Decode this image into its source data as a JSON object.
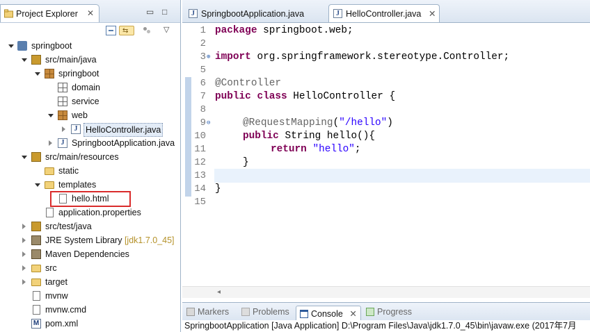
{
  "project_explorer": {
    "title": "Project Explorer",
    "close": "✕",
    "minimize": "▭",
    "maximize": "□",
    "menu": "▽"
  },
  "tree": [
    {
      "label": "springboot",
      "icon": "maven-project-icon"
    },
    {
      "label": "src/main/java",
      "icon": "source-folder-icon"
    },
    {
      "label": "springboot",
      "icon": "package-icon"
    },
    {
      "label": "domain",
      "icon": "empty-package-icon"
    },
    {
      "label": "service",
      "icon": "empty-package-icon"
    },
    {
      "label": "web",
      "icon": "package-icon"
    },
    {
      "label": "HelloController.java",
      "icon": "java-file-icon"
    },
    {
      "label": "SpringbootApplication.java",
      "icon": "java-file-icon"
    },
    {
      "label": "src/main/resources",
      "icon": "source-folder-icon"
    },
    {
      "label": "static",
      "icon": "folder-icon"
    },
    {
      "label": "templates",
      "icon": "folder-icon"
    },
    {
      "label": "hello.html",
      "icon": "html-file-icon"
    },
    {
      "label": "application.properties",
      "icon": "properties-file-icon"
    },
    {
      "label": "src/test/java",
      "icon": "source-folder-icon"
    },
    {
      "label": "JRE System Library",
      "decoration": "[jdk1.7.0_45]",
      "icon": "library-icon"
    },
    {
      "label": "Maven Dependencies",
      "icon": "library-icon"
    },
    {
      "label": "src",
      "icon": "folder-icon"
    },
    {
      "label": "target",
      "icon": "folder-icon"
    },
    {
      "label": "mvnw",
      "icon": "file-icon"
    },
    {
      "label": "mvnw.cmd",
      "icon": "file-icon"
    },
    {
      "label": "pom.xml",
      "icon": "maven-pom-icon"
    }
  ],
  "editor_tabs": [
    {
      "label": "SpringbootApplication.java",
      "active": false
    },
    {
      "label": "HelloController.java",
      "active": true
    }
  ],
  "editor_close": "✕",
  "code": {
    "line_numbers": [
      "1",
      "2",
      "3",
      "5",
      "6",
      "7",
      "8",
      "9",
      "10",
      "11",
      "12",
      "13",
      "14",
      "15"
    ],
    "l1_kw": "package",
    "l1_rest": " springboot.web;",
    "l3_kw": "import",
    "l3_rest": " org.springframework.stereotype.Controller;",
    "l6_an": "@Controller",
    "l7_kw1": "public",
    "l7_kw2": "class",
    "l7_rest": " HelloController {",
    "l9_an": "@RequestMapping",
    "l9_open": "(",
    "l9_str": "\"/hello\"",
    "l9_close": ")",
    "l10_kw": "public",
    "l10_rest": " String hello(){",
    "l11_kw": "return",
    "l11_str": "\"hello\"",
    "l11_end": ";",
    "l12": "}",
    "l14": "}"
  },
  "bottom_tabs": {
    "markers": "Markers",
    "problems": "Problems",
    "console": "Console",
    "progress": "Progress",
    "close": "✕"
  },
  "console_text": "SpringbootApplication [Java Application] D:\\Program Files\\Java\\jdk1.7.0_45\\bin\\javaw.exe (2017年7月",
  "colors": {
    "keyword": "#7f0055",
    "annotation": "#646464",
    "string": "#2a00ff",
    "highlight_box": "#d92b2b"
  }
}
